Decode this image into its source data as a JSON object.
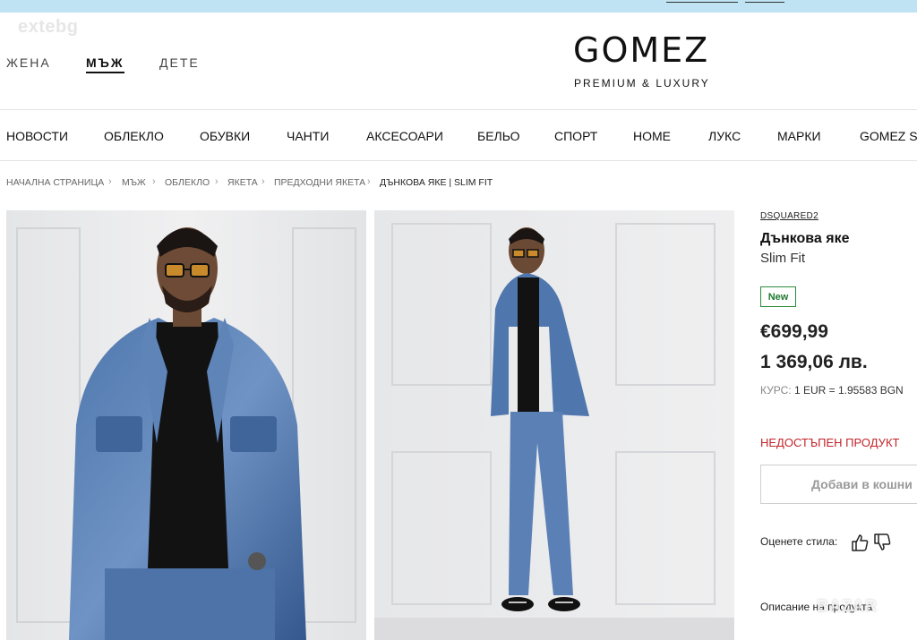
{
  "watermark_top": "extebg",
  "watermark_bottom": "BAZAR",
  "gender_nav": [
    {
      "label": "ЖЕНА",
      "active": false
    },
    {
      "label": "МЪЖ",
      "active": true
    },
    {
      "label": "ДЕТЕ",
      "active": false
    }
  ],
  "logo": {
    "name": "GOMEZ",
    "tagline": "PREMIUM & LUXURY"
  },
  "main_menu": [
    "НОВОСТИ",
    "ОБЛЕКЛО",
    "ОБУВКИ",
    "ЧАНТИ",
    "АКСЕСОАРИ",
    "БЕЛЬО",
    "СПОРТ",
    "HOME",
    "ЛУКС",
    "МАРКИ",
    "GOMEZ ST"
  ],
  "breadcrumb": [
    "НАЧАЛНА СТРАНИЦА",
    "МЪЖ",
    "ОБЛЕКЛО",
    "ЯКЕТА",
    "ПРЕДХОДНИ ЯКЕТА",
    "ДЪНКОВА ЯКЕ | SLIM FIT"
  ],
  "breadcrumb_separator": "›",
  "product": {
    "brand": "DSQUARED2",
    "name": "Дънкова яке",
    "subtitle": "Slim Fit",
    "badge": "New",
    "price_eur": "€699,99",
    "price_bgn": "1 369,06 лв.",
    "rate_label": "КУРС:",
    "rate_value": "1 EUR = 1.95583 BGN",
    "availability": "НЕДОСТЪПЕН ПРОДУКТ",
    "add_to_cart": "Добави в кошни",
    "rate_style_label": "Оценете стила:",
    "description_label": "Описание на продукта"
  },
  "icons": {
    "like": "thumbs-up-icon",
    "dislike": "thumbs-down-icon"
  },
  "colors": {
    "accent_red": "#c0242a",
    "badge_green": "#1f7a2e",
    "top_strip": "#bfe3f3"
  }
}
